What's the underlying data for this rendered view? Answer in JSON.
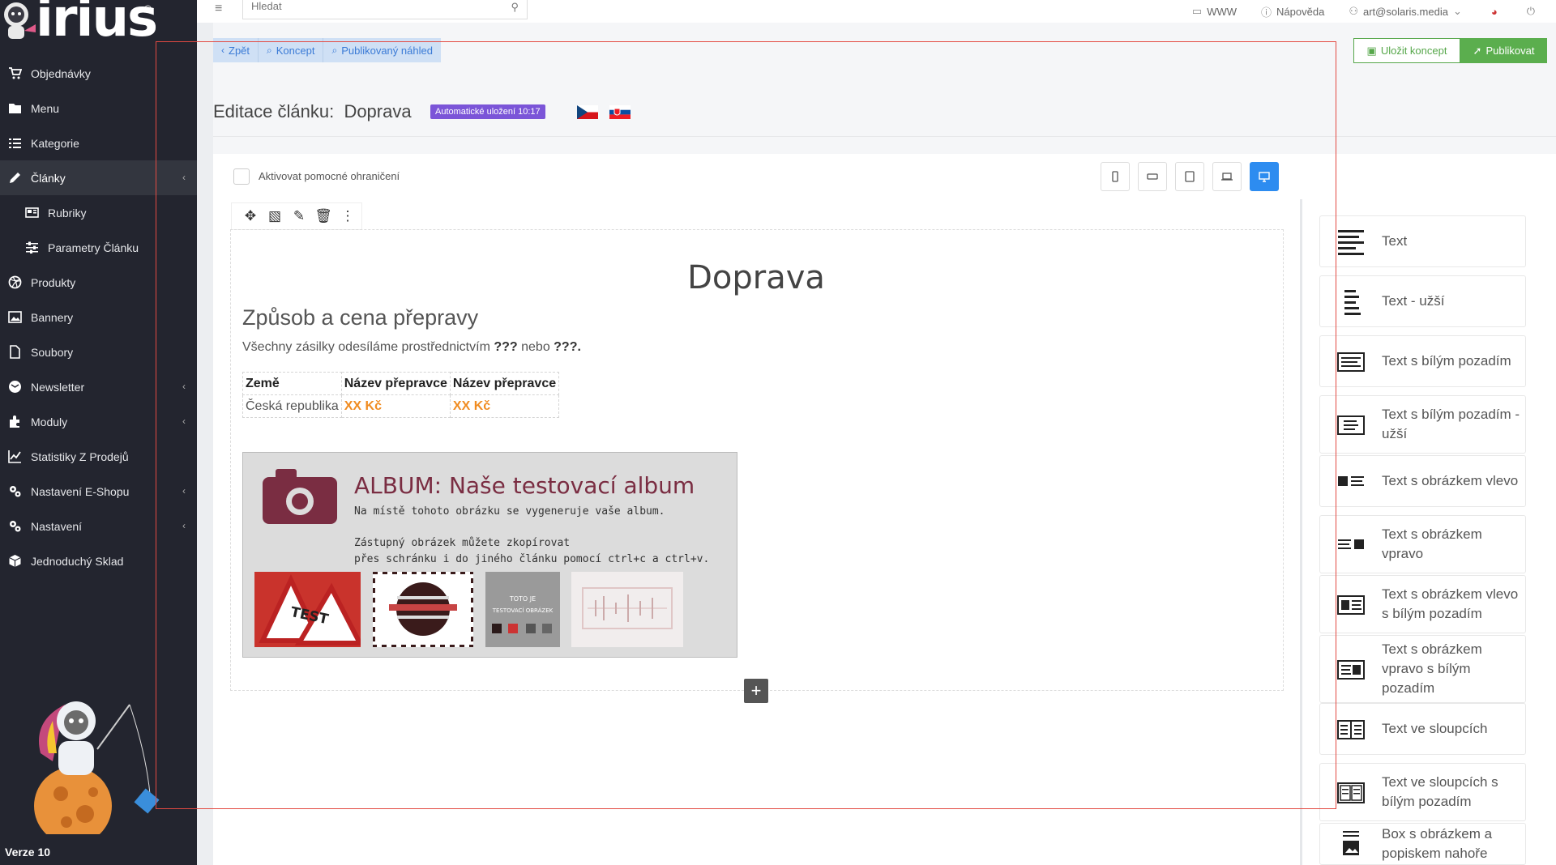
{
  "brand": {
    "logo_text": "irius",
    "reg": "®"
  },
  "sidebar": {
    "items": [
      {
        "label": "Objednávky",
        "icon": "cart-icon",
        "chevron": false
      },
      {
        "label": "Menu",
        "icon": "folder-icon",
        "chevron": false
      },
      {
        "label": "Kategorie",
        "icon": "list-icon",
        "chevron": false
      },
      {
        "label": "Články",
        "icon": "pencil-icon",
        "chevron": true
      },
      {
        "label": "Rubriky",
        "icon": "newspaper-icon",
        "chevron": false,
        "sub": true
      },
      {
        "label": "Parametry Článku",
        "icon": "sliders-icon",
        "chevron": false,
        "sub": true
      },
      {
        "label": "Produkty",
        "icon": "dribbble-icon",
        "chevron": false
      },
      {
        "label": "Bannery",
        "icon": "image-icon",
        "chevron": false
      },
      {
        "label": "Soubory",
        "icon": "file-icon",
        "chevron": false
      },
      {
        "label": "Newsletter",
        "icon": "envelope-icon",
        "chevron": true
      },
      {
        "label": "Moduly",
        "icon": "puzzle-icon",
        "chevron": true
      },
      {
        "label": "Statistiky Z Prodejů",
        "icon": "chart-icon",
        "chevron": false
      },
      {
        "label": "Nastavení E-Shopu",
        "icon": "cogs-icon",
        "chevron": true
      },
      {
        "label": "Nastavení",
        "icon": "cogs-icon",
        "chevron": true
      },
      {
        "label": "Jednoduchý Sklad",
        "icon": "boxes-icon",
        "chevron": false
      }
    ],
    "version": "Verze 10"
  },
  "topbar": {
    "search_placeholder": "Hledat",
    "links": [
      {
        "label": "WWW",
        "icon": "monitor-icon"
      },
      {
        "label": "Nápověda",
        "icon": "info-icon"
      },
      {
        "label": "art@solaris.media",
        "icon": "user-icon"
      }
    ]
  },
  "actions": {
    "back": "Zpět",
    "draft": "Koncept",
    "preview": "Publikovaný náhled",
    "save_draft": "Uložit koncept",
    "publish": "Publikovat"
  },
  "header": {
    "title_prefix": "Editace článku:",
    "title_name": "Doprava",
    "autosave": "Automatické uložení 10:17"
  },
  "editor": {
    "helper_label": "Aktivovat pomocné ohraničení",
    "doc_title": "Doprava",
    "heading": "Způsob a cena přepravy",
    "para_pre": "Všechny zásilky odesíláme prostřednictvím ",
    "para_b1": "???",
    "para_mid": " nebo ",
    "para_b2": "???.",
    "table": {
      "headers": [
        "Země",
        "Název přepravce",
        "Název přepravce"
      ],
      "rows": [
        [
          "Česká republika",
          "XX Kč",
          "XX Kč"
        ]
      ]
    },
    "album": {
      "title": "ALBUM: Naše testovací album",
      "line1": "Na místě tohoto obrázku se vygeneruje vaše album.",
      "line2": "Zástupný obrázek můžete zkopírovat",
      "line3": "přes schránku i do jiného článku pomocí ctrl+c a ctrl+v.",
      "thumb3_line1": "TOTO JE",
      "thumb3_line2": "TESTOVACÍ OBRÁZEK",
      "thumb1_text": "TEST"
    }
  },
  "widgets": [
    {
      "label": "Text",
      "icon": "text-align-icon"
    },
    {
      "label": "Text - užší",
      "icon": "text-narrow-icon"
    },
    {
      "label": "Text s bílým pozadím",
      "icon": "text-box-icon"
    },
    {
      "label": "Text s bílým pozadím - užší",
      "icon": "text-box-narrow-icon"
    },
    {
      "label": "Text s obrázkem vlevo",
      "icon": "text-image-left-icon"
    },
    {
      "label": "Text s obrázkem vpravo",
      "icon": "text-image-right-icon"
    },
    {
      "label": "Text s obrázkem vlevo s bílým pozadím",
      "icon": "text-image-left-box-icon"
    },
    {
      "label": "Text s obrázkem vpravo s bílým pozadím",
      "icon": "text-image-right-box-icon"
    },
    {
      "label": "Text ve sloupcích",
      "icon": "columns-icon"
    },
    {
      "label": "Text ve sloupcích s bílým pozadím",
      "icon": "columns-box-icon"
    },
    {
      "label": "Box s obrázkem a popiskem nahoře",
      "icon": "image-caption-icon"
    }
  ],
  "colors": {
    "sidebar_bg": "#23252f",
    "accent_blue": "#2d8cf0",
    "publish_green": "#5bae4e",
    "autosave_purple": "#7b55d8",
    "price_orange": "#f08c21",
    "album_title": "#7a2d42"
  }
}
